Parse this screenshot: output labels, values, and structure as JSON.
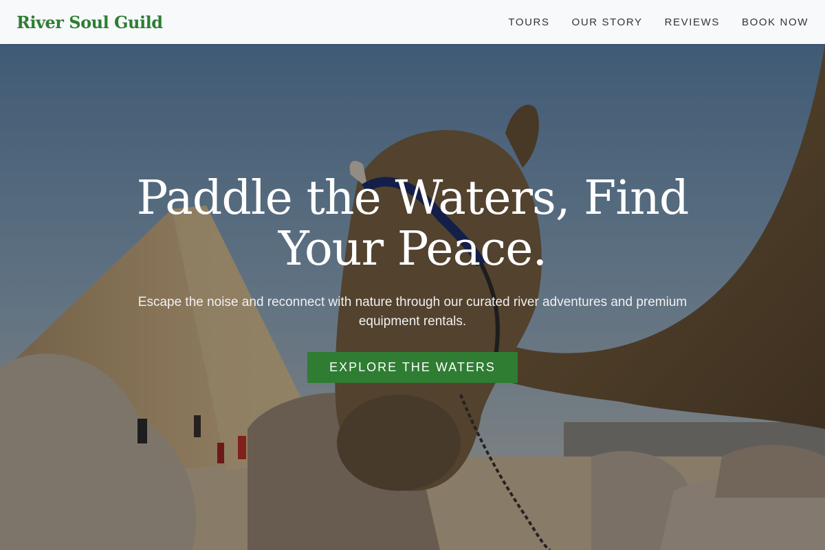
{
  "brand": {
    "name": "River Soul Guild"
  },
  "nav": {
    "items": [
      {
        "label": "TOURS"
      },
      {
        "label": "OUR STORY"
      },
      {
        "label": "REVIEWS"
      },
      {
        "label": "BOOK NOW"
      }
    ]
  },
  "hero": {
    "title": "Paddle the Waters, Find Your Peace.",
    "subtitle": "Escape the noise and reconnect with nature through our curated river adventures and premium equipment rentals.",
    "cta_label": "EXPLORE THE WATERS"
  },
  "colors": {
    "accent": "#2e7d32",
    "nav_background": "#f7f9fb",
    "nav_text": "#333333"
  }
}
